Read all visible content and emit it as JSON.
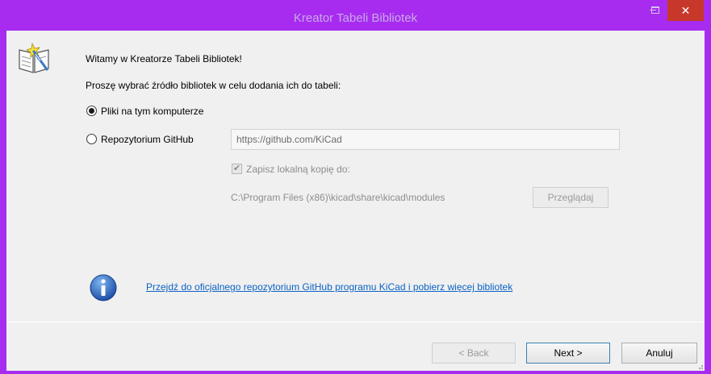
{
  "window": {
    "title": "Kreator Tabeli Bibliotek",
    "controls": {
      "minimize": "–",
      "close": "✕"
    }
  },
  "wizard": {
    "welcome": "Witamy w Kreatorze Tabeli Bibliotek!",
    "prompt": "Proszę wybrać źródło bibliotek w celu dodania ich do tabeli:",
    "options": [
      {
        "label": "Pliki na tym komputerze",
        "selected": true
      },
      {
        "label": "Repozytorium GitHub",
        "selected": false
      }
    ],
    "github_url": "https://github.com/KiCad",
    "save_local_copy_label": "Zapisz lokalną kopię do:",
    "save_local_copy_checked": true,
    "local_path": "C:\\Program Files (x86)\\kicad\\share\\kicad\\modules",
    "browse_label": "Przeglądaj",
    "info_link": "Przejdź do oficjalnego repozytorium GitHub programu KiCad i pobierz więcej bibliotek"
  },
  "footer": {
    "back_label": "< Back",
    "next_label": "Next >",
    "cancel_label": "Anuluj"
  },
  "colors": {
    "titlebar": "#a72cf0",
    "close_button": "#c7382b",
    "link": "#0b62c4",
    "dialog_bg": "#f0f0f0"
  }
}
